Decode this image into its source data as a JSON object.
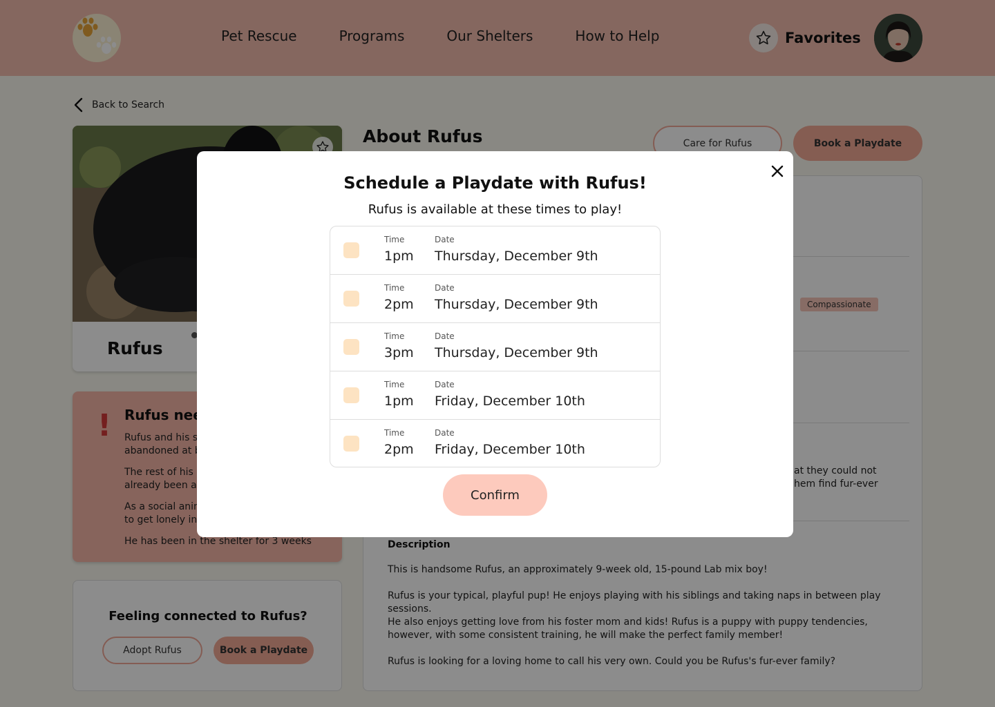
{
  "header": {
    "nav": [
      "Pet Rescue",
      "Programs",
      "Our Shelters",
      "How to Help"
    ],
    "favorites_label": "Favorites"
  },
  "back_label": "Back to Search",
  "pet": {
    "name": "Rufus",
    "needs_title": "Rufus needs",
    "needs_paragraphs": [
      "Rufus and his si",
      "abandoned at b",
      "The rest of his s",
      "already been ad",
      "As a social anim",
      "to get lonely in t",
      "He has been in the shelter for 3 weeks"
    ]
  },
  "connect": {
    "title": "Feeling connected to Rufus?",
    "adopt_label": "Adopt Rufus",
    "playdate_label": "Book a Playdate"
  },
  "about": {
    "title": "About Rufus",
    "care_label": "Care for Rufus",
    "book_label": "Book a Playdate",
    "tag": "Compassionate",
    "peek_lines": [
      "at they could not",
      "hem find fur-ever"
    ],
    "description_title": "Description",
    "description": [
      "This is handsome Rufus, an approximately 9-week old, 15-pound Lab mix boy!",
      "Rufus is your typical, playful pup! He enjoys playing with his siblings and taking naps in between play sessions.",
      "He also enjoys getting love from his foster mom and kids! Rufus is a puppy with puppy tendencies, however, with some consistent training, he will make the perfect family member!",
      "Rufus is looking for a loving home to call his very own. Could you be Rufus's fur-ever family?"
    ]
  },
  "modal": {
    "title": "Schedule a Playdate with Rufus!",
    "subtitle": "Rufus is available at these times to play!",
    "time_label": "Time",
    "date_label": "Date",
    "slots": [
      {
        "time": "1pm",
        "date": "Thursday, December 9th"
      },
      {
        "time": "2pm",
        "date": "Thursday, December 9th"
      },
      {
        "time": "3pm",
        "date": "Thursday, December 9th"
      },
      {
        "time": "1pm",
        "date": "Friday, December 10th"
      },
      {
        "time": "2pm",
        "date": "Friday, December 10th"
      }
    ],
    "confirm_label": "Confirm"
  },
  "colors": {
    "header": "#f2bcae",
    "accent": "#f3a996",
    "checkbox": "#fde3c2",
    "alert": "#d43a3a"
  }
}
